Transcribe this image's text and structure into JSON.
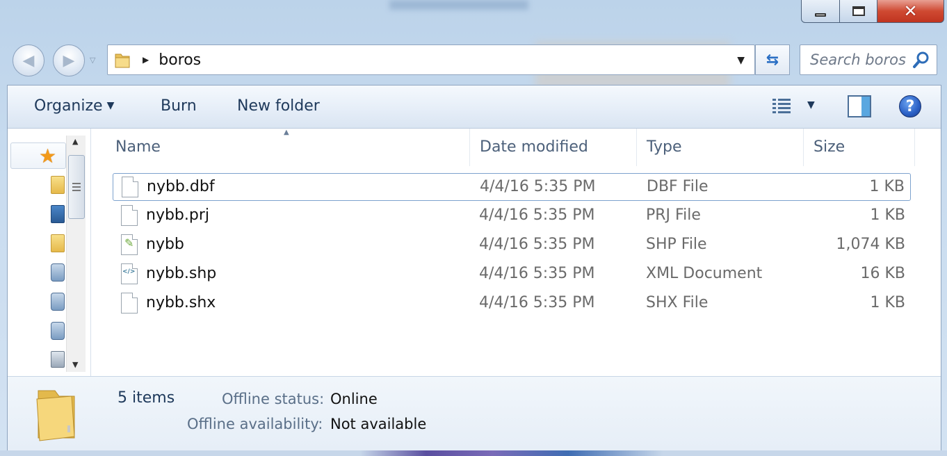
{
  "window": {
    "caption_buttons": {
      "minimize_icon": "minimize-icon",
      "maximize_icon": "maximize-icon",
      "close_icon": "close-icon"
    }
  },
  "nav": {
    "back_icon": "back-arrow-icon",
    "forward_icon": "forward-arrow-icon",
    "recent_dropdown_icon": "chevron-down-icon"
  },
  "address": {
    "folder_icon": "folder-icon",
    "path": "boros",
    "refresh_icon": "refresh-icon"
  },
  "search": {
    "placeholder": "Search boros",
    "icon": "search-icon"
  },
  "toolbar": {
    "organize_label": "Organize",
    "burn_label": "Burn",
    "new_folder_label": "New folder",
    "views_icon": "details-view-icon",
    "preview_icon": "preview-pane-icon",
    "help_icon": "help-icon"
  },
  "columns": {
    "name": "Name",
    "date": "Date modified",
    "type": "Type",
    "size": "Size"
  },
  "files": [
    {
      "name": "nybb.dbf",
      "date": "4/4/16 5:35 PM",
      "type": "DBF File",
      "size": "1 KB",
      "icon": "file-icon",
      "selected": true
    },
    {
      "name": "nybb.prj",
      "date": "4/4/16 5:35 PM",
      "type": "PRJ File",
      "size": "1 KB",
      "icon": "file-icon",
      "selected": false
    },
    {
      "name": "nybb",
      "date": "4/4/16 5:35 PM",
      "type": "SHP File",
      "size": "1,074 KB",
      "icon": "shp-file-icon",
      "selected": false
    },
    {
      "name": "nybb.shp",
      "date": "4/4/16 5:35 PM",
      "type": "XML Document",
      "size": "16 KB",
      "icon": "xml-file-icon",
      "selected": false
    },
    {
      "name": "nybb.shx",
      "date": "4/4/16 5:35 PM",
      "type": "SHX File",
      "size": "1 KB",
      "icon": "file-icon",
      "selected": false
    }
  ],
  "details": {
    "item_count": "5 items",
    "offline_status_label": "Offline status:",
    "offline_status_value": "Online",
    "offline_availability_label": "Offline availability:",
    "offline_availability_value": "Not available"
  },
  "colors": {
    "toolbar_text": "#1e395b",
    "selection_border": "#7da2ce",
    "close_button": "#c03420"
  }
}
